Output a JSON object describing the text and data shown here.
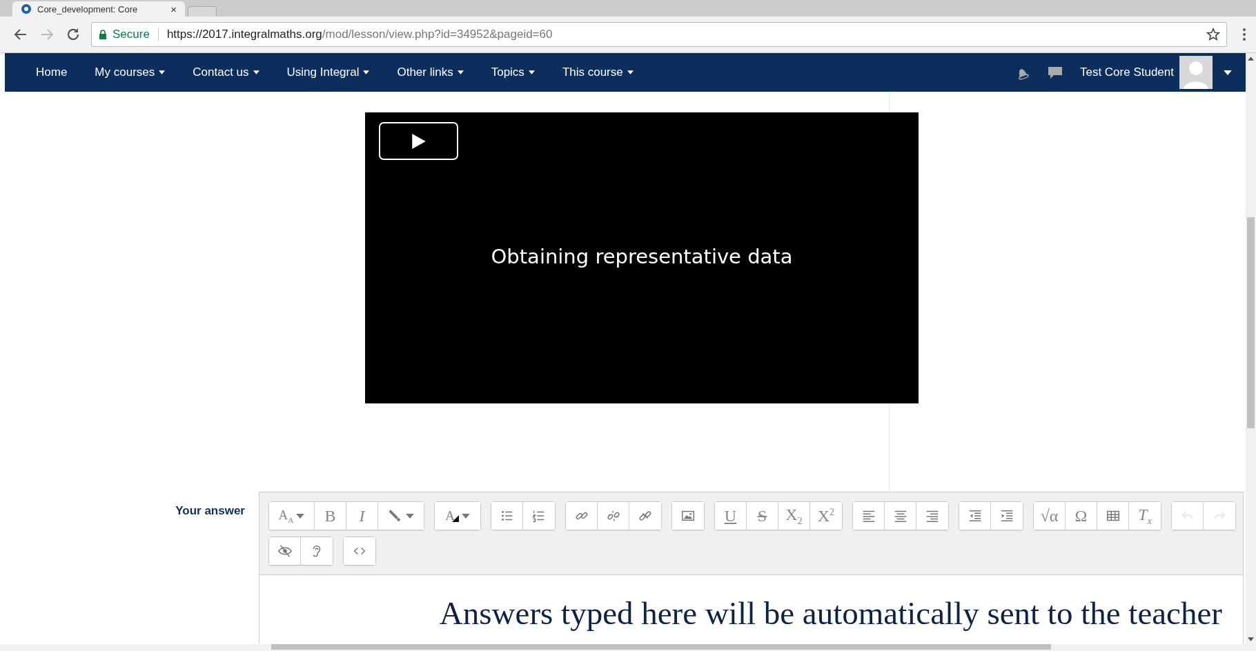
{
  "browser": {
    "tab": {
      "title": "Core_development: Core",
      "close": "×"
    },
    "address": {
      "secure_label": "Secure",
      "url_host": "https://2017.integralmaths.org",
      "url_path": "/mod/lesson/view.php?id=34952&pageid=60"
    }
  },
  "navbar": {
    "items": [
      {
        "label": "Home",
        "dropdown": false
      },
      {
        "label": "My courses",
        "dropdown": true
      },
      {
        "label": "Contact us",
        "dropdown": true
      },
      {
        "label": "Using Integral",
        "dropdown": true
      },
      {
        "label": "Other links",
        "dropdown": true
      },
      {
        "label": "Topics",
        "dropdown": true
      },
      {
        "label": "This course",
        "dropdown": true
      }
    ],
    "user": {
      "name": "Test Core Student"
    }
  },
  "video": {
    "title": "Obtaining representative data"
  },
  "answer": {
    "label": "Your answer",
    "toolbar": [
      [
        [
          {
            "kind": "glyph-caret",
            "glyph": "A$_{A}$",
            "disabled": false
          },
          {
            "kind": "glyph",
            "glyph": "B",
            "disabled": false
          },
          {
            "kind": "italic",
            "glyph": "I",
            "disabled": false
          },
          {
            "kind": "brush",
            "disabled": false
          }
        ],
        [
          {
            "kind": "color-caret",
            "glyph": "A",
            "disabled": false
          }
        ],
        [
          {
            "kind": "bullets",
            "disabled": false
          },
          {
            "kind": "numbers",
            "disabled": false
          }
        ],
        [
          {
            "kind": "link",
            "disabled": false
          },
          {
            "kind": "unlink",
            "disabled": false
          },
          {
            "kind": "anchor",
            "disabled": false
          }
        ],
        [
          {
            "kind": "image",
            "disabled": false
          }
        ],
        [
          {
            "kind": "underline",
            "glyph": "U",
            "disabled": false
          },
          {
            "kind": "strike",
            "glyph": "S",
            "disabled": false
          },
          {
            "kind": "glyph",
            "glyph": "X$_{2}$",
            "disabled": false
          },
          {
            "kind": "glyph",
            "glyph": "X$^{2}$",
            "disabled": false
          }
        ],
        [
          {
            "kind": "align-left",
            "disabled": false
          },
          {
            "kind": "align-center",
            "disabled": false
          },
          {
            "kind": "align-right",
            "disabled": false
          }
        ],
        [
          {
            "kind": "outdent",
            "disabled": false
          },
          {
            "kind": "indent",
            "disabled": false
          }
        ],
        [
          {
            "kind": "glyph",
            "glyph": "√α",
            "disabled": false
          },
          {
            "kind": "glyph",
            "glyph": "Ω",
            "disabled": false
          },
          {
            "kind": "table",
            "disabled": false
          },
          {
            "kind": "italic",
            "glyph": "T$_{x}$",
            "disabled": false
          }
        ],
        [
          {
            "kind": "undo",
            "disabled": true
          },
          {
            "kind": "redo",
            "disabled": true
          }
        ]
      ],
      [
        [
          {
            "kind": "eye",
            "disabled": false
          },
          {
            "kind": "ear",
            "disabled": false
          }
        ],
        [
          {
            "kind": "code",
            "disabled": false
          }
        ]
      ]
    ],
    "content": "Answers typed here will be automatically sent to the teacher"
  }
}
